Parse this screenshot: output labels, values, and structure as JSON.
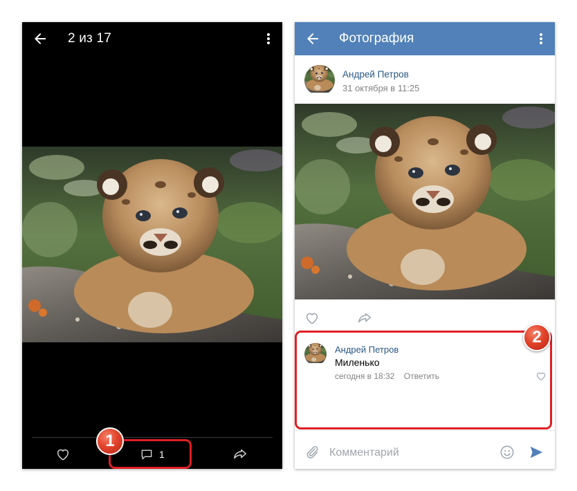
{
  "viewer": {
    "counter": "2 из 17",
    "comments_count": "1"
  },
  "post": {
    "header_title": "Фотография",
    "author": "Андрей Петров",
    "date": "31 октября в 11:25"
  },
  "comment": {
    "author": "Андрей Петров",
    "text": "Миленько",
    "time": "сегодня в 18:32",
    "reply_label": "Ответить"
  },
  "composer": {
    "placeholder": "Комментарий"
  },
  "annotations": {
    "badge_1": "1",
    "badge_2": "2",
    "color": "#e01e24"
  },
  "colors": {
    "header_blue": "#5181b8",
    "link_blue": "#2a5885",
    "icon_grey": "#9aa3ad",
    "send_blue": "#5181b8"
  },
  "icons": [
    "arrow-back-icon",
    "more-vertical-icon",
    "heart-icon",
    "comment-icon",
    "share-icon",
    "attach-icon",
    "emoji-icon",
    "send-icon"
  ]
}
